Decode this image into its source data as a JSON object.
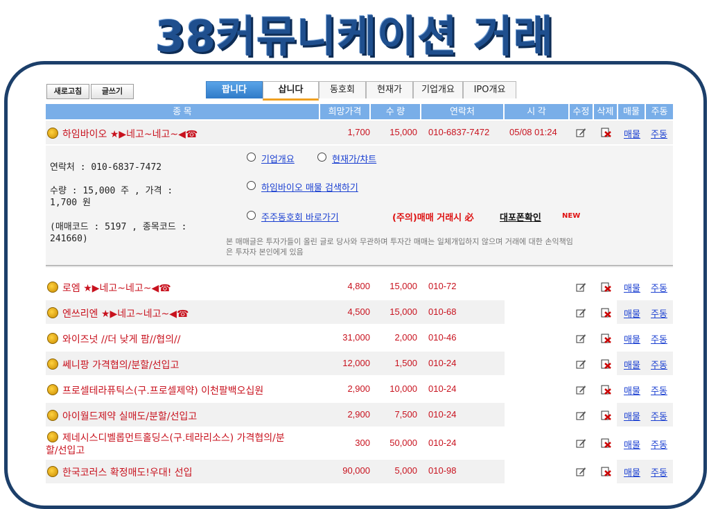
{
  "headline": "38커뮤니케이션 거래",
  "toolbar": {
    "refresh": "새로고침",
    "write": "글쓰기"
  },
  "tabs": [
    "팝니다",
    "삽니다",
    "동호회",
    "현재가",
    "기업개요",
    "IPO개요"
  ],
  "columns": [
    "종      목",
    "희망가격",
    "수 량",
    "연락처",
    "시 각",
    "수정",
    "삭제",
    "매물",
    "주동"
  ],
  "first_row": {
    "name": "하임바이오 ★▶네고~네고~◀☎",
    "price": "1,700",
    "qty": "15,000",
    "phone": "010-6837-7472",
    "time": "05/08 01:24",
    "link1": "매물",
    "link2": "주동"
  },
  "detail": {
    "contact": "연락처 : 010-6837-7472",
    "qty_price_1": "수량 : 15,000 주 , 가격 :",
    "qty_price_2": "1,700 원",
    "codes_1": "(매매코드 : 5197 , 종목코드 :",
    "codes_2": "241660)",
    "opt1": "기업개요",
    "opt2": "현재가/챠트",
    "opt3": "하임바이오 매물 검색하기",
    "opt4": "주주동호회 바로가기",
    "warn": "(주의)매매 거래시 必",
    "warn_link": "대포폰확인",
    "new_badge": "NEW",
    "note_1": "본 매매글은 투자가들이 올린 글로 당사와 무관하며 투자간 매매는 일체개입하지 않으며 거래에 대한 손익책임",
    "note_2": "은 투자자 본인에게 있음"
  },
  "rows": [
    {
      "name": "로엠 ★▶네고~네고~◀☎",
      "price": "4,800",
      "qty": "15,000",
      "phone": "010-72",
      "link1": "매물",
      "link2": "주동"
    },
    {
      "name": "엔쓰리엔 ★▶네고~네고~◀☎",
      "price": "4,500",
      "qty": "15,000",
      "phone": "010-68",
      "link1": "매물",
      "link2": "주동"
    },
    {
      "name": "와이즈넛 //더 낮게 팜//협의//",
      "price": "31,000",
      "qty": "2,000",
      "phone": "010-46",
      "link1": "매물",
      "link2": "주동"
    },
    {
      "name": "쎄니팡 가격협의/분할/선입고",
      "price": "12,000",
      "qty": "1,500",
      "phone": "010-24",
      "link1": "매물",
      "link2": "주동"
    },
    {
      "name": "프로셀테라퓨틱스(구.프로셀제약) 이천팔백오십원",
      "price": "2,900",
      "qty": "10,000",
      "phone": "010-24",
      "link1": "매물",
      "link2": "주동"
    },
    {
      "name": "아이월드제약 실매도/분할/선입고",
      "price": "2,900",
      "qty": "7,500",
      "phone": "010-24",
      "link1": "매물",
      "link2": "주동"
    },
    {
      "name": "제네시스디벨롭먼트홀딩스(구.테라리소스) 가격협의/분",
      "name2": "할/선입고",
      "price": "300",
      "qty": "50,000",
      "phone": "010-24",
      "link1": "매물",
      "link2": "주동"
    },
    {
      "name": "한국코러스 확정매도!우대! 선입",
      "price": "90,000",
      "qty": "5,000",
      "phone": "010-98",
      "link1": "매물",
      "link2": "주동"
    }
  ]
}
